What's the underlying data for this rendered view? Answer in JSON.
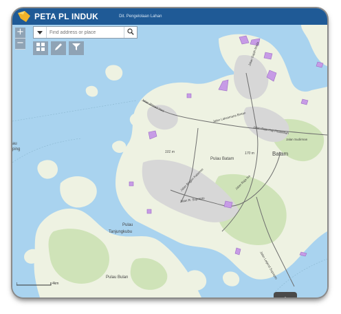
{
  "header": {
    "title": "PETA PL INDUK",
    "subtitle": "Dit. Pengelolaan Lahan"
  },
  "zoom": {
    "in_label": "+",
    "out_label": "−"
  },
  "search": {
    "placeholder": "Find address or place"
  },
  "toolbar": {
    "items": [
      "basemap-gallery",
      "edit",
      "filter"
    ]
  },
  "scale": {
    "label": "4km"
  },
  "map_labels": {
    "batam": "Batam",
    "pulau_batam": "Pulau Batam",
    "pulau_tanjungkubu_1": "Pulau",
    "pulau_tanjungkubu_2": "Tanjungkubu",
    "pulau_bulan": "Pulau Bulan",
    "left_edge_1": "au",
    "left_edge_2": "ping",
    "road_1": "Jalan Ahmad Yani",
    "road_2": "Jalan Laksamana Bintan",
    "road_3": "Jalan Raja Haji Fisabilillah",
    "road_4": "Jalan Brigjen Katamso",
    "road_5": "Jalan Raja Isa",
    "road_6": "Jalan R. Suprapto",
    "road_7": "Jalan Letjend Suprapto",
    "road_8": "Jalan Gajah Mada",
    "road_9": "Jalan Sudirman",
    "elev_1": "101 m",
    "elev_2": "170 m"
  },
  "colors": {
    "water": "#a9d3ef",
    "land": "#eef2e2",
    "forest": "#cfe3b8",
    "urban": "#d7d7d7",
    "parcel": "#c79be6",
    "header": "#1f5a96"
  }
}
